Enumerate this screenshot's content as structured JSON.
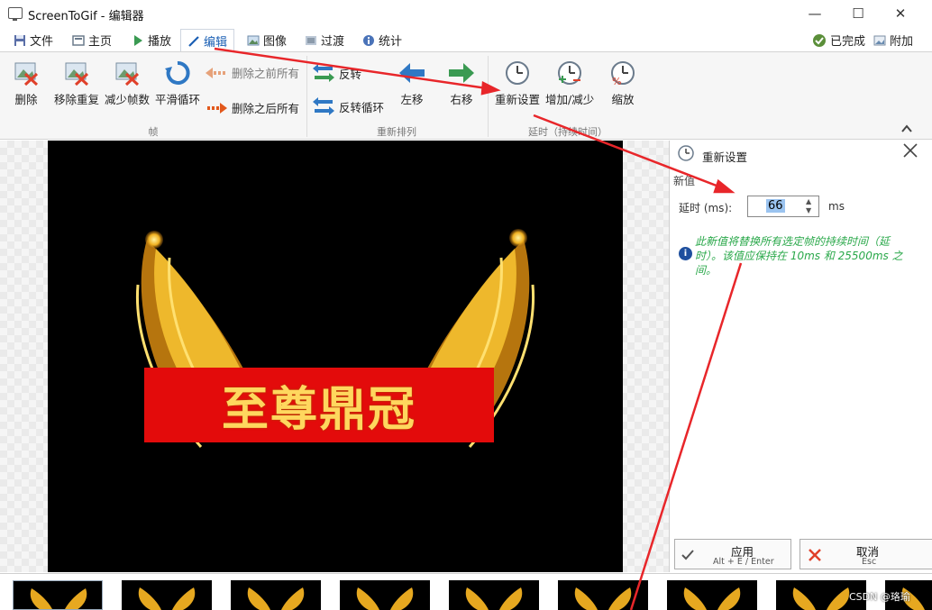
{
  "window": {
    "title": "ScreenToGif - 编辑器",
    "minimize_label": "—",
    "maximize_label": "☐",
    "close_label": "✕"
  },
  "tabs": [
    {
      "label": "文件",
      "icon": "save-icon"
    },
    {
      "label": "主页",
      "icon": "home-icon"
    },
    {
      "label": "播放",
      "icon": "play-icon"
    },
    {
      "label": "编辑",
      "icon": "pencil-icon",
      "active": true
    },
    {
      "label": "图像",
      "icon": "image-icon"
    },
    {
      "label": "过渡",
      "icon": "transition-icon"
    },
    {
      "label": "统计",
      "icon": "info-icon"
    }
  ],
  "tab_actions": {
    "done_label": "已完成",
    "attach_label": "附加"
  },
  "ribbon": {
    "frames_group": {
      "label": "帧",
      "delete": "删除",
      "remove_duplicates": "移除重复",
      "reduce_frames": "减少帧数",
      "smooth_loop": "平滑循环",
      "delete_previous": "删除之前所有",
      "delete_next": "删除之后所有"
    },
    "reorder_group": {
      "label": "重新排列",
      "reverse": "反转",
      "yoyo": "反转循环",
      "move_left": "左移",
      "move_right": "右移"
    },
    "delay_group": {
      "label": "延时（持续时间）",
      "override": "重新设置",
      "increase_decrease": "增加/减少",
      "scale": "缩放"
    }
  },
  "canvas": {
    "banner_text": "至尊鼎冠"
  },
  "panel": {
    "title": "重新设置",
    "section": "新值",
    "delay_label": "延时 (ms):",
    "delay_value": "66",
    "delay_unit": "ms",
    "info_text": "此新值将替换所有选定帧的持续时间（延时）。该值应保持在 10ms 和 25500ms 之间。",
    "apply_label": "应用",
    "apply_shortcut": "Alt + E / Enter",
    "cancel_label": "取消",
    "cancel_shortcut": "Esc"
  },
  "watermark": "CSDN @珞瑜",
  "colors": {
    "accent": "#1a5fb4",
    "annotation_arrow": "#e8262a",
    "info_text": "#2aa84a",
    "banner_bg": "#e30b0b",
    "banner_text": "#ffd75e"
  }
}
